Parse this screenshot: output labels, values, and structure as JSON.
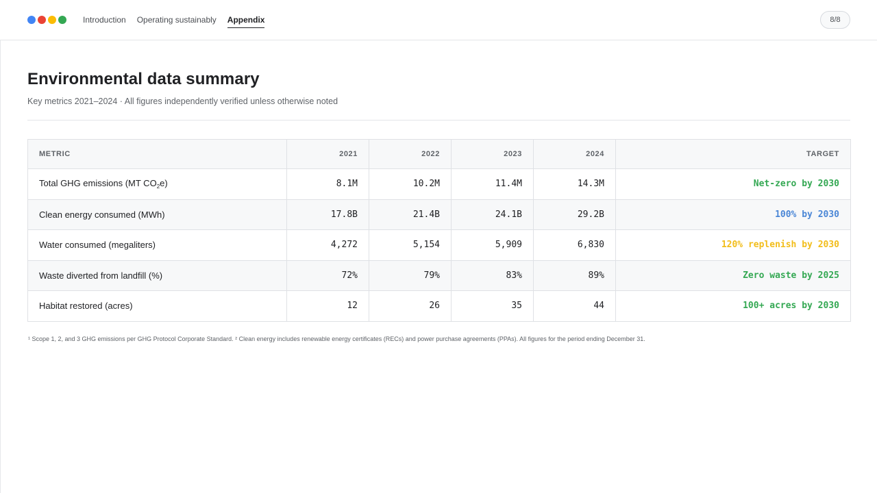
{
  "brand": {
    "dot_colors": [
      "#4285f4",
      "#ea4335",
      "#fbbc04",
      "#34a853"
    ]
  },
  "nav": {
    "items": [
      {
        "label": "Introduction"
      },
      {
        "label": "Operating sustainably"
      },
      {
        "label": "Appendix",
        "active": true
      }
    ]
  },
  "page_indicator": "8/8",
  "header": {
    "title": "Environmental data summary",
    "subtitle": "Key metrics 2021–2024 · All figures independently verified unless otherwise noted"
  },
  "table": {
    "columns": [
      "METRIC",
      "2021",
      "2022",
      "2023",
      "2024",
      "TARGET"
    ],
    "rows": [
      {
        "metric_before_sub": "Total GHG emissions (MT CO",
        "metric_sub": "2",
        "metric_after_sub": "e)",
        "values": [
          "8.1M",
          "10.2M",
          "11.4M",
          "14.3M"
        ],
        "target": "Net-zero by 2030",
        "target_color": "#34a853"
      },
      {
        "metric": "Clean energy consumed (MWh)",
        "values": [
          "17.8B",
          "21.4B",
          "24.1B",
          "29.2B"
        ],
        "target": "100% by 2030",
        "target_color": "#4a86d6"
      },
      {
        "metric": "Water consumed (megaliters)",
        "values": [
          "4,272",
          "5,154",
          "5,909",
          "6,830"
        ],
        "target": "120% replenish by 2030",
        "target_color": "#f2bd1a"
      },
      {
        "metric": "Waste diverted from landfill (%)",
        "values": [
          "72%",
          "79%",
          "83%",
          "89%"
        ],
        "target": "Zero waste by 2025",
        "target_color": "#34a853"
      },
      {
        "metric": "Habitat restored (acres)",
        "values": [
          "12",
          "26",
          "35",
          "44"
        ],
        "target": "100+ acres by 2030",
        "target_color": "#34a853"
      }
    ]
  },
  "footnote": "¹ Scope 1, 2, and 3 GHG emissions per GHG Protocol Corporate Standard. ² Clean energy includes renewable energy certificates (RECs) and power purchase agreements (PPAs). All figures for the period ending December 31."
}
